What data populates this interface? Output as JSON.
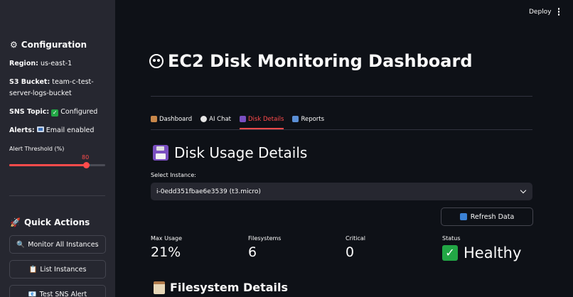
{
  "sidebar": {
    "config_heading": "Configuration",
    "region_label": "Region:",
    "region_value": "us-east-1",
    "s3_label": "S3 Bucket:",
    "s3_value": "team-c-test-server-logs-bucket",
    "sns_label": "SNS Topic:",
    "sns_value": "Configured",
    "alerts_label": "Alerts:",
    "alerts_value": "Email enabled",
    "threshold_label": "Alert Threshold (%)",
    "threshold_value": "80",
    "threshold_fraction": 0.8,
    "quick_actions_heading": "Quick Actions",
    "buttons": [
      "Monitor All Instances",
      "List Instances",
      "Test SNS Alert"
    ]
  },
  "header": {
    "deploy_label": "Deploy"
  },
  "main": {
    "title": "EC2 Disk Monitoring Dashboard",
    "tabs": [
      {
        "label": "Dashboard",
        "icon": "house-icon",
        "active": false
      },
      {
        "label": "AI Chat",
        "icon": "speech-bubble-icon",
        "active": false
      },
      {
        "label": "Disk Details",
        "icon": "floppy-disk-icon",
        "active": true
      },
      {
        "label": "Reports",
        "icon": "bar-chart-icon",
        "active": false
      }
    ],
    "section_title": "Disk Usage Details",
    "select_label": "Select Instance:",
    "select_value": "i-0edd351fbae6e3539 (t3.micro)",
    "refresh_label": "Refresh Data",
    "metrics": {
      "max_usage_label": "Max Usage",
      "max_usage_value": "21%",
      "filesystems_label": "Filesystems",
      "filesystems_value": "6",
      "critical_label": "Critical",
      "critical_value": "0",
      "status_label": "Status",
      "status_value": "Healthy"
    },
    "filesystem_title": "Filesystem Details"
  },
  "colors": {
    "accent": "#ff4b4b",
    "background": "#0e1117",
    "sidebar": "#262730",
    "success": "#22a745"
  }
}
